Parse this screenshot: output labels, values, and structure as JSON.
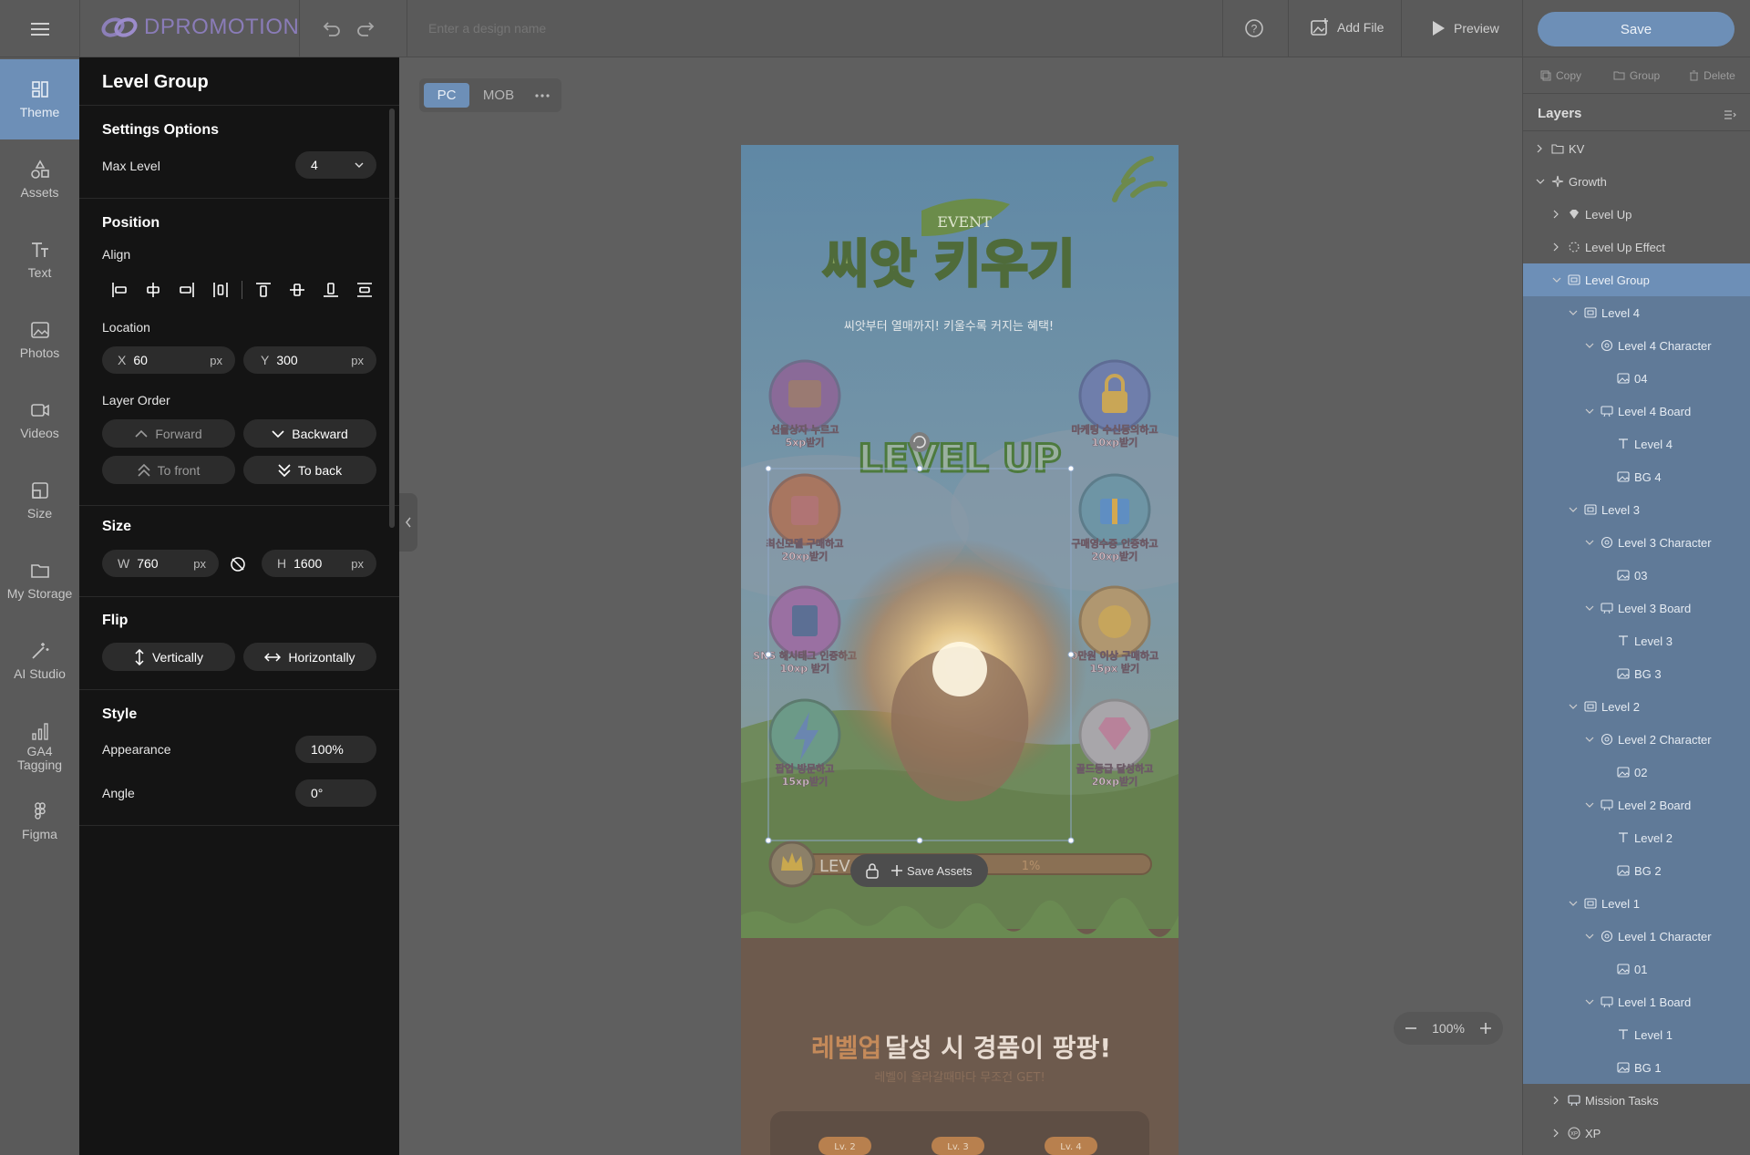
{
  "brand": {
    "logo_text": "DPROMOTION"
  },
  "header": {
    "design_name_placeholder": "Enter a design name",
    "add_file_label": "Add File",
    "preview_label": "Preview",
    "save_label": "Save"
  },
  "nav": {
    "items": [
      {
        "label": "Theme",
        "icon": "theme-icon"
      },
      {
        "label": "Assets",
        "icon": "shapes-icon"
      },
      {
        "label": "Text",
        "icon": "text-icon"
      },
      {
        "label": "Photos",
        "icon": "image-icon"
      },
      {
        "label": "Videos",
        "icon": "video-icon"
      },
      {
        "label": "Size",
        "icon": "resize-icon"
      },
      {
        "label": "My Storage",
        "icon": "folder-icon"
      },
      {
        "label": "AI Studio",
        "icon": "magic-wand-icon"
      },
      {
        "label": "GA4 Tagging",
        "icon": "analytics-icon"
      },
      {
        "label": "Figma",
        "icon": "figma-icon"
      }
    ],
    "active": "Theme"
  },
  "panel": {
    "title": "Level Group",
    "settings": {
      "title": "Settings Options",
      "max_level_label": "Max Level",
      "max_level_value": "4"
    },
    "position": {
      "title": "Position",
      "align_label": "Align",
      "location_label": "Location",
      "x_prefix": "X",
      "x_value": "60",
      "y_prefix": "Y",
      "y_value": "300",
      "unit": "px",
      "layer_order_label": "Layer Order",
      "forward": "Forward",
      "backward": "Backward",
      "to_front": "To front",
      "to_back": "To back"
    },
    "size": {
      "title": "Size",
      "w_prefix": "W",
      "w_value": "760",
      "h_prefix": "H",
      "h_value": "1600",
      "unit": "px"
    },
    "flip": {
      "title": "Flip",
      "vertically": "Vertically",
      "horizontally": "Horizontally"
    },
    "style": {
      "title": "Style",
      "appearance_label": "Appearance",
      "appearance_value": "100%",
      "angle_label": "Angle",
      "angle_value": "0°"
    }
  },
  "canvas": {
    "device_tabs": [
      "PC",
      "MOB"
    ],
    "active_device": "PC",
    "zoom": "100%",
    "save_assets_label": "Save Assets",
    "level_bar_text": "LEV",
    "progress_text": "1%",
    "progress": 0.01
  },
  "artwork": {
    "event_tag": "EVENT",
    "title": "씨앗 키우기",
    "subtitle": "씨앗부터 열매까지! 키울수록 커지는 혜택!",
    "level_up_text": "LEVEL UP",
    "missions_left": [
      {
        "line1": "선물상자 누르고",
        "line2": "5xp받기"
      },
      {
        "line1": "최신모델 구매하고",
        "line2": "20xp받기"
      },
      {
        "line1": "SNS 해시태그 인증하고",
        "line2": "10xp 받기"
      },
      {
        "line1": "팝업 방문하고",
        "line2": "15xp받기"
      }
    ],
    "missions_right": [
      {
        "line1": "마케팅 수신동의하고",
        "line2": "10xp받기"
      },
      {
        "line1": "구매영수증 인증하고",
        "line2": "20xp받기"
      },
      {
        "line1": "0만원 이상 구매하고",
        "line2": "15px 받기"
      },
      {
        "line1": "골드등급 달성하고",
        "line2": "20xp받기"
      }
    ],
    "bottom_title_accent": "레벨업",
    "bottom_title_rest": " 달성 시 경품이 팡팡!",
    "bottom_subtitle": "레벨이 올라갈때마다 무조건 GET!",
    "level_badges": [
      "Lv. 2",
      "Lv. 3",
      "Lv. 4"
    ]
  },
  "toolbar_right": {
    "copy": "Copy",
    "group": "Group",
    "delete": "Delete"
  },
  "layers": {
    "title": "Layers",
    "items": [
      {
        "label": "KV",
        "depth": 0,
        "chev": "right",
        "icon": "folder"
      },
      {
        "label": "Growth",
        "depth": 0,
        "chev": "down",
        "icon": "sparkle"
      },
      {
        "label": "Level Up",
        "depth": 1,
        "chev": "right",
        "icon": "diamond"
      },
      {
        "label": "Level Up Effect",
        "depth": 1,
        "chev": "right",
        "icon": "burst"
      },
      {
        "label": "Level Group",
        "depth": 1,
        "chev": "down",
        "icon": "frame",
        "state": "selected"
      },
      {
        "label": "Level 4",
        "depth": 2,
        "chev": "down",
        "icon": "frame",
        "state": "group"
      },
      {
        "label": "Level 4 Character",
        "depth": 3,
        "chev": "down",
        "icon": "circle",
        "state": "group"
      },
      {
        "label": "04",
        "depth": 4,
        "chev": "",
        "icon": "image",
        "state": "group"
      },
      {
        "label": "Level 4 Board",
        "depth": 3,
        "chev": "down",
        "icon": "board",
        "state": "group"
      },
      {
        "label": "Level 4",
        "depth": 4,
        "chev": "",
        "icon": "text",
        "state": "group"
      },
      {
        "label": "BG 4",
        "depth": 4,
        "chev": "",
        "icon": "image",
        "state": "group"
      },
      {
        "label": "Level 3",
        "depth": 2,
        "chev": "down",
        "icon": "frame",
        "state": "group"
      },
      {
        "label": "Level 3 Character",
        "depth": 3,
        "chev": "down",
        "icon": "circle",
        "state": "group"
      },
      {
        "label": "03",
        "depth": 4,
        "chev": "",
        "icon": "image",
        "state": "group"
      },
      {
        "label": "Level 3 Board",
        "depth": 3,
        "chev": "down",
        "icon": "board",
        "state": "group"
      },
      {
        "label": "Level 3",
        "depth": 4,
        "chev": "",
        "icon": "text",
        "state": "group"
      },
      {
        "label": "BG 3",
        "depth": 4,
        "chev": "",
        "icon": "image",
        "state": "group"
      },
      {
        "label": "Level 2",
        "depth": 2,
        "chev": "down",
        "icon": "frame",
        "state": "group"
      },
      {
        "label": "Level 2 Character",
        "depth": 3,
        "chev": "down",
        "icon": "circle",
        "state": "group"
      },
      {
        "label": "02",
        "depth": 4,
        "chev": "",
        "icon": "image",
        "state": "group"
      },
      {
        "label": "Level 2 Board",
        "depth": 3,
        "chev": "down",
        "icon": "board",
        "state": "group"
      },
      {
        "label": "Level 2",
        "depth": 4,
        "chev": "",
        "icon": "text",
        "state": "group"
      },
      {
        "label": "BG 2",
        "depth": 4,
        "chev": "",
        "icon": "image",
        "state": "group"
      },
      {
        "label": "Level 1",
        "depth": 2,
        "chev": "down",
        "icon": "frame",
        "state": "group"
      },
      {
        "label": "Level 1 Character",
        "depth": 3,
        "chev": "down",
        "icon": "circle",
        "state": "group"
      },
      {
        "label": "01",
        "depth": 4,
        "chev": "",
        "icon": "image",
        "state": "group"
      },
      {
        "label": "Level 1 Board",
        "depth": 3,
        "chev": "down",
        "icon": "board",
        "state": "group"
      },
      {
        "label": "Level 1",
        "depth": 4,
        "chev": "",
        "icon": "text",
        "state": "group"
      },
      {
        "label": "BG 1",
        "depth": 4,
        "chev": "",
        "icon": "image",
        "state": "group"
      },
      {
        "label": "Mission Tasks",
        "depth": 1,
        "chev": "right",
        "icon": "board"
      },
      {
        "label": "XP",
        "depth": 1,
        "chev": "right",
        "icon": "xp"
      }
    ]
  },
  "colors": {
    "accent": "#6d8fb7",
    "panel_bg": "#141414",
    "overlay_gray": "#5a5a5a"
  }
}
